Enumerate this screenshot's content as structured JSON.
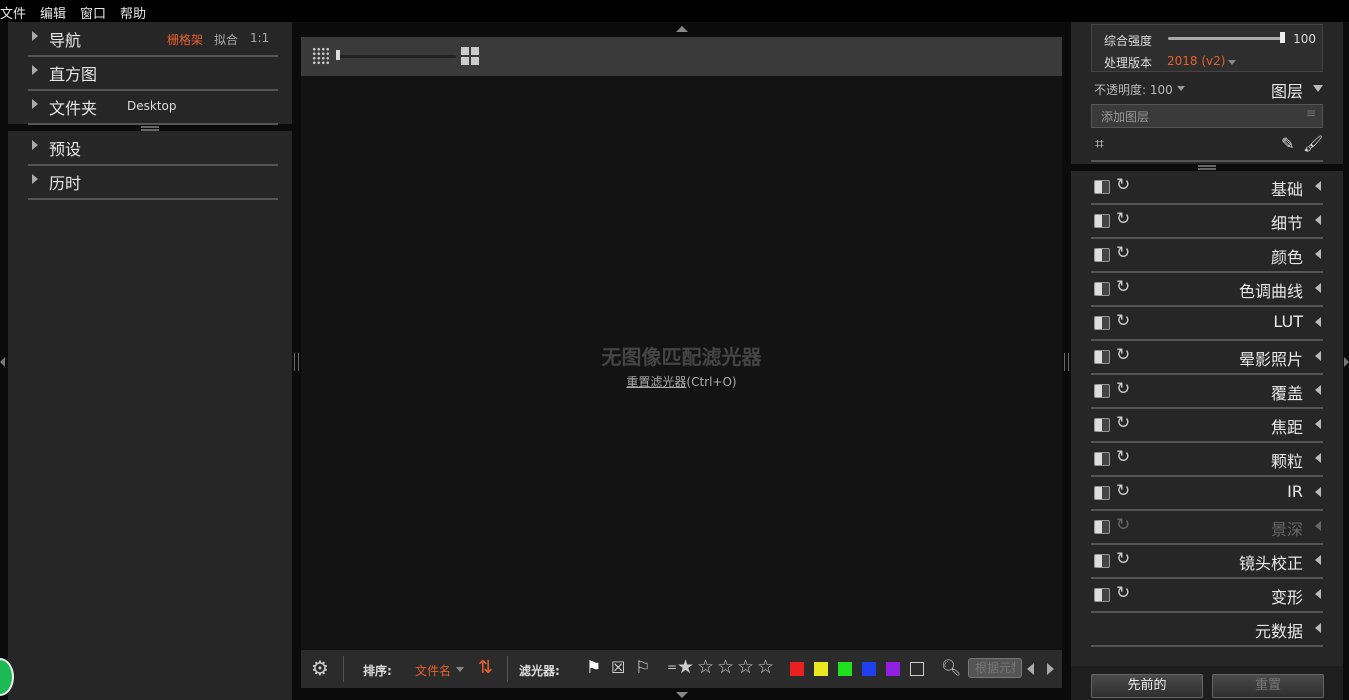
{
  "menu": [
    "文件",
    "编辑",
    "窗口",
    "帮助"
  ],
  "left": {
    "nav": {
      "label": "导航",
      "options": [
        "栅格架",
        "拟合",
        "1:1"
      ]
    },
    "histogram": {
      "label": "直方图"
    },
    "folder": {
      "label": "文件夹",
      "value": "Desktop"
    },
    "presets": {
      "label": "预设"
    },
    "history": {
      "label": "历时"
    }
  },
  "center": {
    "empty_title": "无图像匹配滤光器",
    "reset_link": "重置滤光器",
    "reset_shortcut": "(Ctrl+O)"
  },
  "bottom": {
    "sort_label": "排序:",
    "sort_value": "文件名",
    "filter_label": "滤光器:",
    "rating_prefix": "=",
    "search_placeholder": "根据元数",
    "stars": [
      "★",
      "☆",
      "☆",
      "☆",
      "☆"
    ],
    "color_labels": [
      "#e82020",
      "#e8e820",
      "#20e020",
      "#2040f0",
      "#9020e0"
    ]
  },
  "right": {
    "strength_label": "综合强度",
    "strength_value": "100",
    "strength_level": 1.0,
    "process_label": "处理版本",
    "process_value": "2018 (v2)",
    "opacity_label": "不透明度: 100",
    "layers_label": "图层",
    "add_layer": "添加图层",
    "adjustments": [
      "基础",
      "细节",
      "颜色",
      "色调曲线",
      "LUT",
      "晕影照片",
      "覆盖",
      "焦距",
      "颗粒",
      "IR",
      "景深",
      "镜头校正",
      "变形",
      "元数据"
    ],
    "previous_button": "先前的",
    "reset_button": "重置"
  },
  "colors": {
    "accent": "#e8602c"
  }
}
